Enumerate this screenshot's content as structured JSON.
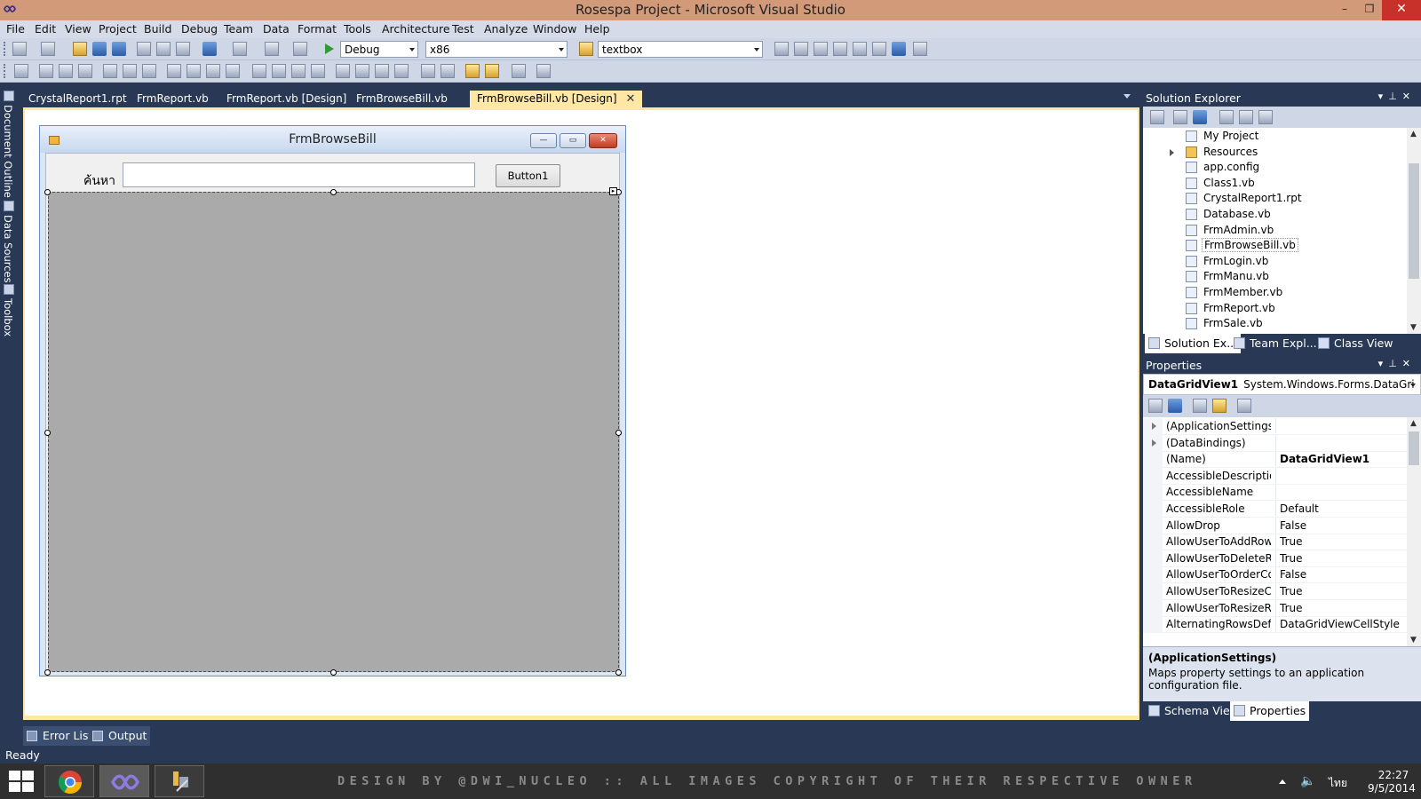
{
  "window": {
    "title": "Rosespa Project - Microsoft Visual Studio",
    "minimize": "–",
    "restore": "❐",
    "close": "✕"
  },
  "menu": [
    "File",
    "Edit",
    "View",
    "Project",
    "Build",
    "Debug",
    "Team",
    "Data",
    "Format",
    "Tools",
    "Architecture",
    "Test",
    "Analyze",
    "Window",
    "Help"
  ],
  "toolbar": {
    "config": "Debug",
    "platform": "x86",
    "find": "textbox"
  },
  "left_strip": [
    "Document Outline",
    "Data Sources",
    "Toolbox"
  ],
  "doc_tabs": [
    {
      "label": "CrystalReport1.rpt",
      "active": false
    },
    {
      "label": "FrmReport.vb",
      "active": false
    },
    {
      "label": "FrmReport.vb [Design]",
      "active": false
    },
    {
      "label": "FrmBrowseBill.vb",
      "active": false
    },
    {
      "label": "FrmBrowseBill.vb [Design]",
      "active": true
    }
  ],
  "designer": {
    "form_title": "FrmBrowseBill",
    "label_text": "ค้นหา",
    "textbox_value": "",
    "button_text": "Button1",
    "smart_tag": "▸"
  },
  "bottom_tabs": [
    "Error List",
    "Output"
  ],
  "status": "Ready",
  "solution_explorer": {
    "title": "Solution Explorer",
    "items": [
      {
        "label": "My Project",
        "folder": false,
        "expandable": false
      },
      {
        "label": "Resources",
        "folder": true,
        "expandable": true
      },
      {
        "label": "app.config",
        "folder": false,
        "expandable": false
      },
      {
        "label": "Class1.vb",
        "folder": false,
        "expandable": false
      },
      {
        "label": "CrystalReport1.rpt",
        "folder": false,
        "expandable": false
      },
      {
        "label": "Database.vb",
        "folder": false,
        "expandable": false
      },
      {
        "label": "FrmAdmin.vb",
        "folder": false,
        "expandable": false
      },
      {
        "label": "FrmBrowseBill.vb",
        "folder": false,
        "expandable": false,
        "selected": true
      },
      {
        "label": "FrmLogin.vb",
        "folder": false,
        "expandable": false
      },
      {
        "label": "FrmManu.vb",
        "folder": false,
        "expandable": false
      },
      {
        "label": "FrmMember.vb",
        "folder": false,
        "expandable": false
      },
      {
        "label": "FrmReport.vb",
        "folder": false,
        "expandable": false
      },
      {
        "label": "FrmSale.vb",
        "folder": false,
        "expandable": false
      }
    ],
    "tabs": [
      "Solution Ex...",
      "Team Expl...",
      "Class View"
    ]
  },
  "properties": {
    "title": "Properties",
    "object_name": "DataGridView1",
    "object_type": "System.Windows.Forms.DataGri",
    "rows": [
      {
        "name": "(ApplicationSettings)",
        "value": "",
        "expandable": true,
        "bold": false
      },
      {
        "name": "(DataBindings)",
        "value": "",
        "expandable": true,
        "bold": false
      },
      {
        "name": "(Name)",
        "value": "DataGridView1",
        "expandable": false,
        "bold": true
      },
      {
        "name": "AccessibleDescription",
        "value": "",
        "expandable": false,
        "bold": false
      },
      {
        "name": "AccessibleName",
        "value": "",
        "expandable": false,
        "bold": false
      },
      {
        "name": "AccessibleRole",
        "value": "Default",
        "expandable": false,
        "bold": false
      },
      {
        "name": "AllowDrop",
        "value": "False",
        "expandable": false,
        "bold": false
      },
      {
        "name": "AllowUserToAddRows",
        "value": "True",
        "expandable": false,
        "bold": false
      },
      {
        "name": "AllowUserToDeleteRov",
        "value": "True",
        "expandable": false,
        "bold": false
      },
      {
        "name": "AllowUserToOrderColu",
        "value": "False",
        "expandable": false,
        "bold": false
      },
      {
        "name": "AllowUserToResizeCol",
        "value": "True",
        "expandable": false,
        "bold": false
      },
      {
        "name": "AllowUserToResizeRov",
        "value": "True",
        "expandable": false,
        "bold": false
      },
      {
        "name": "AlternatingRowsDefau",
        "value": "DataGridViewCellStyle",
        "expandable": false,
        "bold": false
      }
    ],
    "desc_title": "(ApplicationSettings)",
    "desc_text": "Maps property settings to an application configuration file.",
    "tabs": [
      "Schema View",
      "Properties"
    ]
  },
  "taskbar": {
    "watermark": "DESIGN BY @DWI_NUCLEO :: ALL IMAGES COPYRIGHT OF THEIR RESPECTIVE OWNER",
    "language": "ไทย",
    "time": "22:27",
    "date": "9/5/2014"
  }
}
